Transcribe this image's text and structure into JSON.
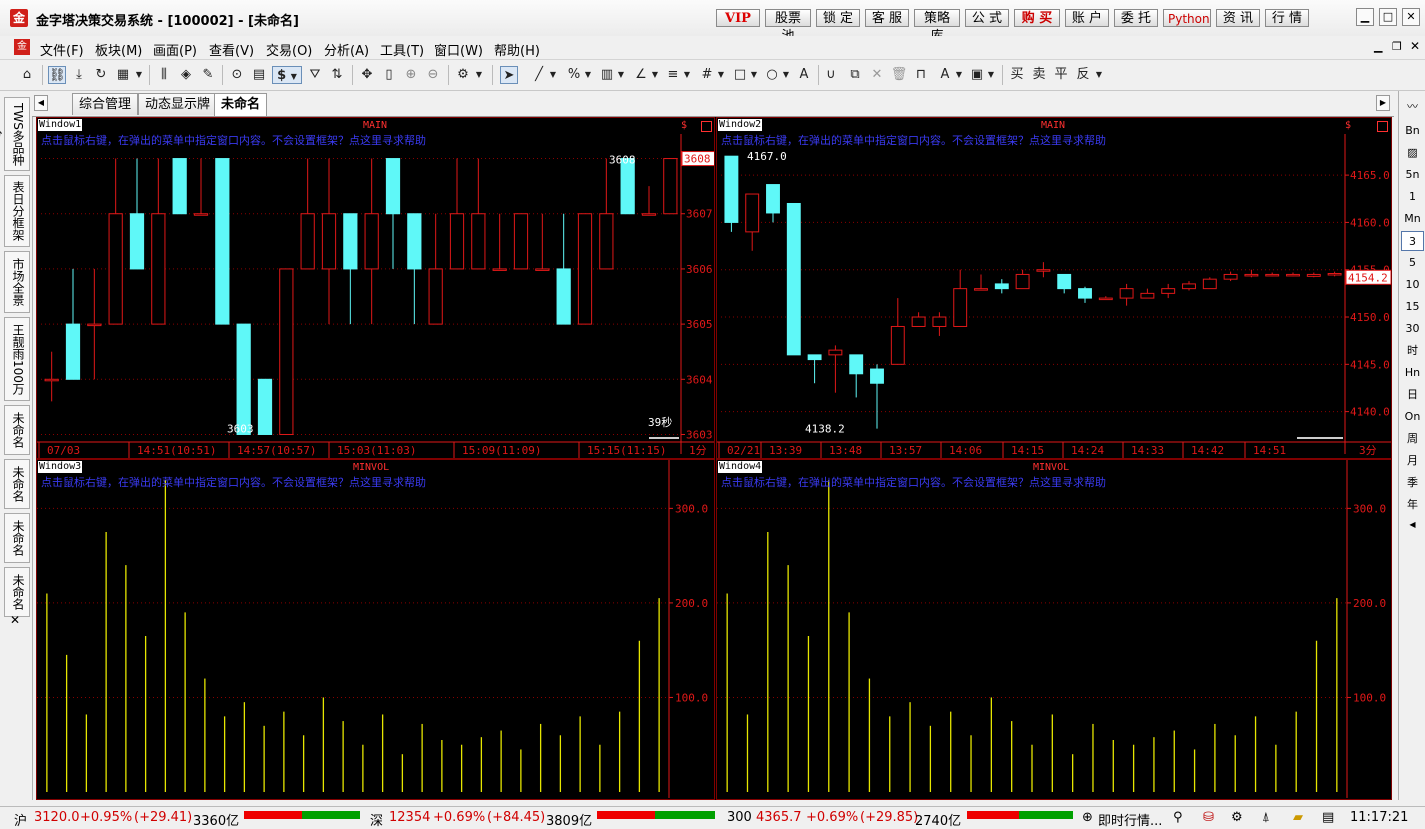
{
  "window": {
    "title": "金字塔决策交易系统 - [100002] - [未命名]",
    "title_buttons": [
      "VIP",
      "股票池",
      "锁 定",
      "客 服",
      "策略库",
      "公 式",
      "购 买",
      "账 户",
      "委 托",
      "Python",
      "资 讯",
      "行 情"
    ],
    "controls": [
      "▁",
      "□",
      "✕"
    ]
  },
  "menu": [
    "文件(F)",
    "板块(M)",
    "画面(P)",
    "查看(V)",
    "交易(O)",
    "分析(A)",
    "工具(T)",
    "窗口(W)",
    "帮助(H)"
  ],
  "toolbar": {
    "currency_symbol": "$",
    "trade_labels": [
      "买",
      "卖",
      "平",
      "反"
    ]
  },
  "tabs": [
    "综合管理",
    "动态显示牌",
    "未命名"
  ],
  "left_tabs": [
    "TWS多品种分",
    "表日分框架",
    "市场全景",
    "王靓雨100万",
    "未命名",
    "未命名",
    "未命名",
    "未命名"
  ],
  "left_close": "✕",
  "right_bar": [
    "Bn",
    "5n",
    "1",
    "Mn",
    "3",
    "5",
    "10",
    "15",
    "30",
    "时",
    "Hn",
    "日",
    "On",
    "周",
    "月",
    "季",
    "年"
  ],
  "right_bar_selected": "3",
  "hint_text": "点击鼠标右键，在弹出的菜单中指定窗口内容。不会设置框架？点这里寻求帮助",
  "panels": {
    "w1": {
      "label": "Window1",
      "title": "MAIN",
      "price_tag": "3608",
      "high_label": "3608",
      "low_label": "3603",
      "timer": "39秒",
      "period": "1分",
      "time_labels": [
        "07/03",
        "14:51(10:51)",
        "14:57(10:57)",
        "15:03(11:03)",
        "15:09(11:09)",
        "15:15(11:15)"
      ]
    },
    "w2": {
      "label": "Window2",
      "title": "MAIN",
      "price_tag": "4154.2",
      "high_label": "4167.0",
      "low_label": "4138.2",
      "period": "3分",
      "time_labels": [
        "02/21",
        "13:39",
        "13:48",
        "13:57",
        "14:06",
        "14:15",
        "14:24",
        "14:33",
        "14:42",
        "14:51"
      ]
    },
    "w3": {
      "label": "Window3",
      "title": "MINVOL"
    },
    "w4": {
      "label": "Window4",
      "title": "MINVOL"
    }
  },
  "chart_data": [
    {
      "type": "candlestick",
      "name": "Window1 MAIN",
      "ylim": [
        3602.9,
        3608.3
      ],
      "y_ticks": [
        3603,
        3604,
        3605,
        3606,
        3607,
        3608
      ],
      "candles": [
        {
          "o": 3604,
          "c": 3604,
          "h": 3604.5,
          "l": 3603.6
        },
        {
          "o": 3605,
          "c": 3604,
          "h": 3606,
          "l": 3604
        },
        {
          "o": 3605,
          "c": 3605,
          "h": 3606,
          "l": 3604
        },
        {
          "o": 3605,
          "c": 3607,
          "h": 3608,
          "l": 3605
        },
        {
          "o": 3607,
          "c": 3606,
          "h": 3608,
          "l": 3606
        },
        {
          "o": 3605,
          "c": 3607,
          "h": 3608,
          "l": 3605
        },
        {
          "o": 3608,
          "c": 3607,
          "h": 3608,
          "l": 3607
        },
        {
          "o": 3607,
          "c": 3607,
          "h": 3608,
          "l": 3607
        },
        {
          "o": 3608,
          "c": 3605,
          "h": 3608,
          "l": 3605
        },
        {
          "o": 3605,
          "c": 3603,
          "h": 3605,
          "l": 3603
        },
        {
          "o": 3604,
          "c": 3603,
          "h": 3604,
          "l": 3603
        },
        {
          "o": 3603,
          "c": 3606,
          "h": 3606,
          "l": 3603
        },
        {
          "o": 3606,
          "c": 3607,
          "h": 3608,
          "l": 3606
        },
        {
          "o": 3606,
          "c": 3607,
          "h": 3608,
          "l": 3605
        },
        {
          "o": 3607,
          "c": 3606,
          "h": 3607,
          "l": 3605
        },
        {
          "o": 3606,
          "c": 3607,
          "h": 3608,
          "l": 3605
        },
        {
          "o": 3608,
          "c": 3607,
          "h": 3608,
          "l": 3606
        },
        {
          "o": 3607,
          "c": 3606,
          "h": 3607,
          "l": 3605
        },
        {
          "o": 3605,
          "c": 3606,
          "h": 3607,
          "l": 3605
        },
        {
          "o": 3606,
          "c": 3607,
          "h": 3608,
          "l": 3606
        },
        {
          "o": 3606,
          "c": 3607,
          "h": 3608,
          "l": 3606
        },
        {
          "o": 3606,
          "c": 3606,
          "h": 3607,
          "l": 3606
        },
        {
          "o": 3606,
          "c": 3607,
          "h": 3607,
          "l": 3606
        },
        {
          "o": 3606,
          "c": 3606,
          "h": 3607,
          "l": 3606
        },
        {
          "o": 3606,
          "c": 3605,
          "h": 3607,
          "l": 3605
        },
        {
          "o": 3605,
          "c": 3607,
          "h": 3607,
          "l": 3605
        },
        {
          "o": 3606,
          "c": 3607,
          "h": 3608,
          "l": 3606
        },
        {
          "o": 3608,
          "c": 3607,
          "h": 3608,
          "l": 3607
        },
        {
          "o": 3607,
          "c": 3607,
          "h": 3607.5,
          "l": 3607
        },
        {
          "o": 3607,
          "c": 3608,
          "h": 3608,
          "l": 3607
        }
      ]
    },
    {
      "type": "candlestick",
      "name": "Window2 MAIN",
      "ylim": [
        4137,
        4168.5
      ],
      "y_ticks": [
        4140,
        4145,
        4150,
        4155,
        4160,
        4165
      ],
      "candles": [
        {
          "o": 4167,
          "c": 4160,
          "h": 4167,
          "l": 4159
        },
        {
          "o": 4159,
          "c": 4163,
          "h": 4163,
          "l": 4157
        },
        {
          "o": 4164,
          "c": 4161,
          "h": 4164,
          "l": 4160
        },
        {
          "o": 4162,
          "c": 4146,
          "h": 4162,
          "l": 4146
        },
        {
          "o": 4146,
          "c": 4145.5,
          "h": 4146,
          "l": 4143
        },
        {
          "o": 4146,
          "c": 4146.5,
          "h": 4147,
          "l": 4142
        },
        {
          "o": 4146,
          "c": 4144,
          "h": 4146,
          "l": 4141.5
        },
        {
          "o": 4144.5,
          "c": 4143,
          "h": 4145,
          "l": 4138.2
        },
        {
          "o": 4145,
          "c": 4149,
          "h": 4152,
          "l": 4145
        },
        {
          "o": 4149,
          "c": 4150,
          "h": 4150.5,
          "l": 4149
        },
        {
          "o": 4149,
          "c": 4150,
          "h": 4150.5,
          "l": 4148
        },
        {
          "o": 4149,
          "c": 4153,
          "h": 4155,
          "l": 4149
        },
        {
          "o": 4153,
          "c": 4153,
          "h": 4154.5,
          "l": 4153
        },
        {
          "o": 4153.5,
          "c": 4153,
          "h": 4154,
          "l": 4152.5
        },
        {
          "o": 4153,
          "c": 4154.5,
          "h": 4155,
          "l": 4153
        },
        {
          "o": 4155,
          "c": 4155,
          "h": 4155.8,
          "l": 4154.2
        },
        {
          "o": 4154.5,
          "c": 4153,
          "h": 4154.5,
          "l": 4152.5
        },
        {
          "o": 4153,
          "c": 4152,
          "h": 4153.2,
          "l": 4151.5
        },
        {
          "o": 4152,
          "c": 4152,
          "h": 4152.2,
          "l": 4151.8
        },
        {
          "o": 4152,
          "c": 4153,
          "h": 4153.5,
          "l": 4151.2
        },
        {
          "o": 4152,
          "c": 4152.5,
          "h": 4153,
          "l": 4152
        },
        {
          "o": 4152.5,
          "c": 4153,
          "h": 4153.5,
          "l": 4152
        },
        {
          "o": 4153,
          "c": 4153.5,
          "h": 4153.8,
          "l": 4152.8
        },
        {
          "o": 4153,
          "c": 4154,
          "h": 4154.2,
          "l": 4153
        },
        {
          "o": 4154,
          "c": 4154.5,
          "h": 4154.8,
          "l": 4153.8
        },
        {
          "o": 4154.5,
          "c": 4154.5,
          "h": 4155,
          "l": 4154.2
        },
        {
          "o": 4154.5,
          "c": 4154.5,
          "h": 4154.7,
          "l": 4154.3
        },
        {
          "o": 4154.5,
          "c": 4154.5,
          "h": 4154.7,
          "l": 4154.3
        },
        {
          "o": 4154.3,
          "c": 4154.5,
          "h": 4154.7,
          "l": 4154.2
        },
        {
          "o": 4154.5,
          "c": 4154.6,
          "h": 4154.8,
          "l": 4154.3
        }
      ]
    },
    {
      "type": "bar",
      "name": "Window3 MINVOL",
      "ylim": [
        0,
        330
      ],
      "y_ticks": [
        100,
        200,
        300
      ],
      "values": [
        210,
        145,
        82,
        275,
        240,
        165,
        330,
        190,
        120,
        80,
        95,
        70,
        85,
        60,
        100,
        75,
        50,
        82,
        40,
        72,
        55,
        50,
        58,
        65,
        45,
        72,
        60,
        80,
        50,
        85,
        160,
        205
      ]
    },
    {
      "type": "bar",
      "name": "Window4 MINVOL",
      "ylim": [
        0,
        330
      ],
      "y_ticks": [
        100,
        200,
        300
      ],
      "values": [
        210,
        82,
        275,
        240,
        165,
        330,
        190,
        120,
        80,
        95,
        70,
        85,
        60,
        100,
        75,
        50,
        82,
        40,
        72,
        55,
        50,
        58,
        65,
        45,
        72,
        60,
        80,
        50,
        85,
        160,
        205
      ]
    }
  ],
  "status": {
    "sh_label": "沪",
    "sh_value": "3120.0",
    "sh_change": "+0.95%",
    "sh_diff": "(+29.41)",
    "sh_amount": "3360亿",
    "sz_label": "深",
    "sz_value": "12354",
    "sz_change": "+0.69%",
    "sz_diff": "(+84.45)",
    "sz_amount": "3809亿",
    "c300_label": "300",
    "c300_value": "4365.7",
    "c300_change": "+0.69%",
    "c300_diff": "(+29.85)",
    "c300_amount": "2740亿",
    "quote_label": "即时行情...",
    "clock": "11:17:21",
    "up_color": "#dd0000",
    "down_color": "#00a000"
  }
}
